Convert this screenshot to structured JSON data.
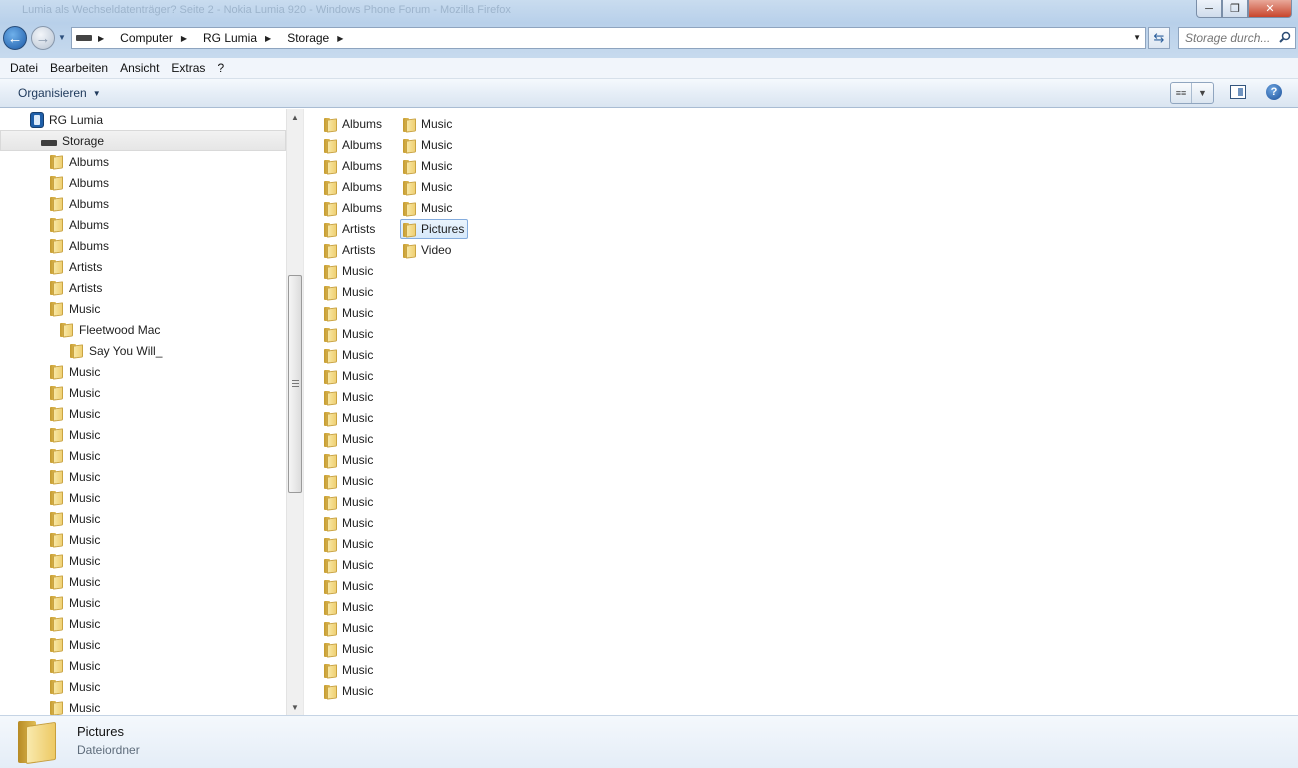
{
  "window": {
    "title": "Lumia als Wechseldatenträger? Seite 2 - Nokia Lumia 920 - Windows Phone Forum - Mozilla Firefox"
  },
  "nav": {
    "breadcrumbs": [
      "Computer",
      "RG Lumia",
      "Storage"
    ],
    "search_placeholder": "Storage durch..."
  },
  "menu": [
    "Datei",
    "Bearbeiten",
    "Ansicht",
    "Extras",
    "?"
  ],
  "toolbar": {
    "organize_label": "Organisieren"
  },
  "tree": [
    {
      "label": "RG Lumia",
      "icon": "phone-icon",
      "indent": 0
    },
    {
      "label": "Storage",
      "icon": "drive-icon",
      "indent": 1,
      "selected": true
    },
    {
      "label": "Albums",
      "icon": "folder-icon",
      "indent": 2
    },
    {
      "label": "Albums",
      "icon": "folder-icon",
      "indent": 2
    },
    {
      "label": "Albums",
      "icon": "folder-icon",
      "indent": 2
    },
    {
      "label": "Albums",
      "icon": "folder-icon",
      "indent": 2
    },
    {
      "label": "Albums",
      "icon": "folder-icon",
      "indent": 2
    },
    {
      "label": "Artists",
      "icon": "folder-icon",
      "indent": 2
    },
    {
      "label": "Artists",
      "icon": "folder-icon",
      "indent": 2
    },
    {
      "label": "Music",
      "icon": "folder-icon",
      "indent": 2
    },
    {
      "label": "Fleetwood Mac",
      "icon": "folder-icon",
      "indent": 3
    },
    {
      "label": "Say You Will_",
      "icon": "folder-icon",
      "indent": 4
    },
    {
      "label": "Music",
      "icon": "folder-icon",
      "indent": 2
    },
    {
      "label": "Music",
      "icon": "folder-icon",
      "indent": 2
    },
    {
      "label": "Music",
      "icon": "folder-icon",
      "indent": 2
    },
    {
      "label": "Music",
      "icon": "folder-icon",
      "indent": 2
    },
    {
      "label": "Music",
      "icon": "folder-icon",
      "indent": 2
    },
    {
      "label": "Music",
      "icon": "folder-icon",
      "indent": 2
    },
    {
      "label": "Music",
      "icon": "folder-icon",
      "indent": 2
    },
    {
      "label": "Music",
      "icon": "folder-icon",
      "indent": 2
    },
    {
      "label": "Music",
      "icon": "folder-icon",
      "indent": 2
    },
    {
      "label": "Music",
      "icon": "folder-icon",
      "indent": 2
    },
    {
      "label": "Music",
      "icon": "folder-icon",
      "indent": 2
    },
    {
      "label": "Music",
      "icon": "folder-icon",
      "indent": 2
    },
    {
      "label": "Music",
      "icon": "folder-icon",
      "indent": 2
    },
    {
      "label": "Music",
      "icon": "folder-icon",
      "indent": 2
    },
    {
      "label": "Music",
      "icon": "folder-icon",
      "indent": 2
    },
    {
      "label": "Music",
      "icon": "folder-icon",
      "indent": 2
    },
    {
      "label": "Music",
      "icon": "folder-icon",
      "indent": 2
    },
    {
      "label": "Music",
      "icon": "folder-icon",
      "indent": 2
    }
  ],
  "content": {
    "columns": [
      [
        "Albums",
        "Albums",
        "Albums",
        "Albums",
        "Albums",
        "Artists",
        "Artists",
        "Music",
        "Music",
        "Music",
        "Music",
        "Music",
        "Music",
        "Music",
        "Music",
        "Music",
        "Music",
        "Music",
        "Music",
        "Music",
        "Music",
        "Music",
        "Music",
        "Music",
        "Music",
        "Music",
        "Music",
        "Music"
      ],
      [
        "Music",
        "Music",
        "Music",
        "Music",
        "Music",
        "Pictures",
        "Video"
      ]
    ],
    "selected": "Pictures"
  },
  "details": {
    "name": "Pictures",
    "type": "Dateiordner"
  },
  "colors": {
    "selection_border": "#84acdd",
    "selection_fill": "#d6e9fb",
    "folder": "#efd073"
  }
}
